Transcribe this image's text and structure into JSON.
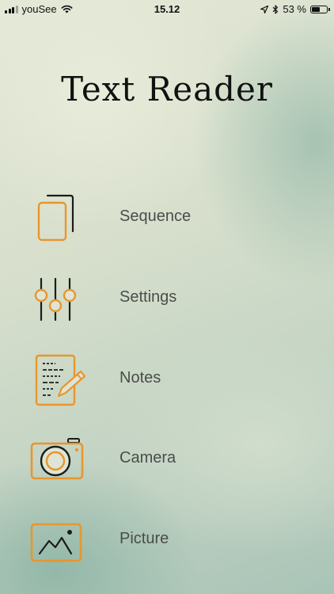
{
  "status_bar": {
    "carrier": "youSee",
    "time": "15.12",
    "battery": "53 %",
    "battery_level": 0.53
  },
  "app": {
    "title": "Text Reader"
  },
  "menu": {
    "items": [
      {
        "label": "Sequence",
        "icon": "sequence-icon"
      },
      {
        "label": "Settings",
        "icon": "sliders-icon"
      },
      {
        "label": "Notes",
        "icon": "notes-icon"
      },
      {
        "label": "Camera",
        "icon": "camera-icon"
      },
      {
        "label": "Picture",
        "icon": "picture-icon"
      }
    ]
  },
  "colors": {
    "accent": "#e8962e",
    "outline": "#1c1c1c",
    "label": "#4a4d4b"
  }
}
